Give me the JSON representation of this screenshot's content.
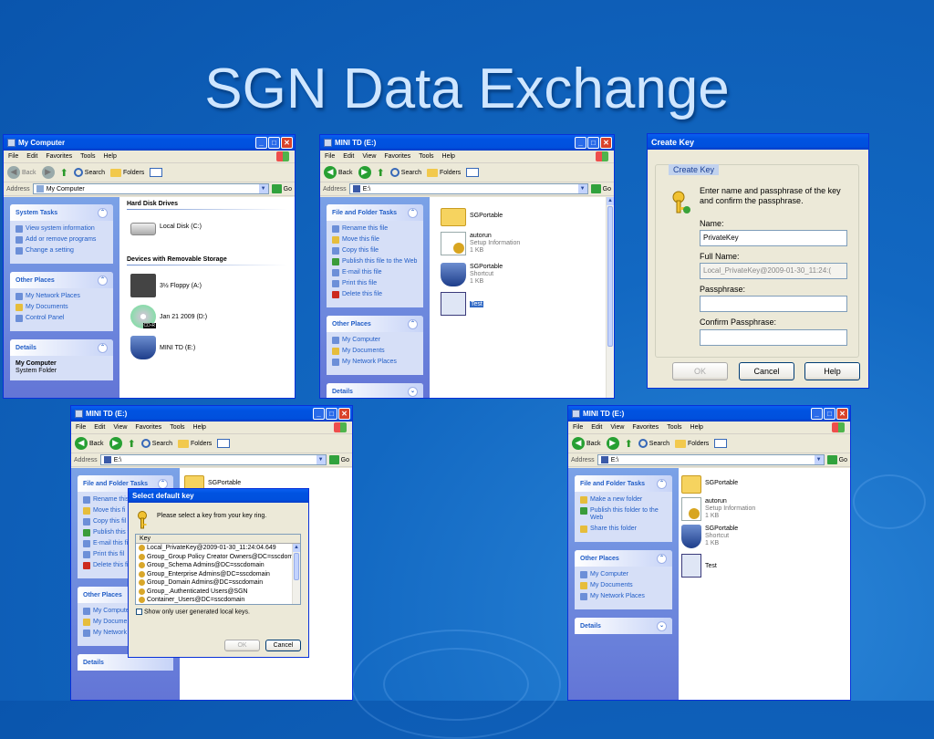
{
  "slide": {
    "title": "SGN Data Exchange"
  },
  "menu": {
    "file": "File",
    "edit": "Edit",
    "view": "View",
    "favorites": "Favorites",
    "tools": "Tools",
    "help": "Help"
  },
  "toolbar": {
    "back": "Back",
    "search": "Search",
    "folders": "Folders",
    "go": "Go",
    "address": "Address"
  },
  "windows": {
    "mycomputer": {
      "title": "My Computer",
      "address": "My Computer",
      "system_tasks": {
        "title": "System Tasks",
        "items": [
          "View system information",
          "Add or remove programs",
          "Change a setting"
        ]
      },
      "other_places": {
        "title": "Other Places",
        "items": [
          "My Network Places",
          "My Documents",
          "Control Panel"
        ]
      },
      "details": {
        "title": "Details",
        "name": "My Computer",
        "type": "System Folder"
      },
      "hdd_header": "Hard Disk Drives",
      "removable_header": "Devices with Removable Storage",
      "drives": [
        "Local Disk (C:)",
        "3½ Floppy (A:)",
        "Jan 21 2009 (D:)",
        "MINI TD (E:)"
      ],
      "cd_badge": "CD-R"
    },
    "minitd1": {
      "title": "MINI TD (E:)",
      "address": "E:\\",
      "tasks": {
        "title": "File and Folder Tasks",
        "items": [
          "Rename this file",
          "Move this file",
          "Copy this file",
          "Publish this file to the Web",
          "E-mail this file",
          "Print this file",
          "Delete this file"
        ]
      },
      "other_places": {
        "title": "Other Places",
        "items": [
          "My Computer",
          "My Documents",
          "My Network Places"
        ]
      },
      "details_title": "Details",
      "files": [
        {
          "name": "SGPortable",
          "sub1": "",
          "sub2": ""
        },
        {
          "name": "autorun",
          "sub1": "Setup Information",
          "sub2": "1 KB"
        },
        {
          "name": "SGPortable",
          "sub1": "Shortcut",
          "sub2": "1 KB"
        },
        {
          "name": "Test",
          "sub1": "",
          "sub2": ""
        }
      ]
    },
    "createkey": {
      "title": "Create Key",
      "legend": "Create Key",
      "instructions": "Enter name and passphrase of the key and confirm the passphrase.",
      "name_label": "Name:",
      "name_value": "PrivateKey",
      "fullname_label": "Full Name:",
      "fullname_value": "Local_PrivateKey@2009-01-30_11:24:(",
      "pass_label": "Passphrase:",
      "confirm_label": "Confirm Passphrase:",
      "ok": "OK",
      "cancel": "Cancel",
      "help": "Help"
    },
    "minitd2": {
      "title": "MINI TD (E:)",
      "address": "E:\\",
      "tasks_title": "File and Folder Tasks",
      "tasks_items": [
        "Rename this",
        "Move this fi",
        "Copy this fil",
        "Publish this fi",
        "E-mail this fi",
        "Print this fil",
        "Delete this fil"
      ],
      "other_title": "Other Places",
      "other_items": [
        "My Compute",
        "My Docume",
        "My Network"
      ],
      "details_title": "Details",
      "folder": "SGPortable"
    },
    "selectkey": {
      "title": "Select default key",
      "message": "Please select a key from your key ring.",
      "column": "Key",
      "keys": [
        "Local_PrivateKey@2009-01-30_11:24:04.649",
        "Group_Group Policy Creator Owners@DC=sscdomain",
        "Group_Schema Admins@DC=sscdomain",
        "Group_Enterprise Admins@DC=sscdomain",
        "Group_Domain Admins@DC=sscdomain",
        "Group_.Authenticated Users@SGN",
        "Container_Users@DC=sscdomain"
      ],
      "checkbox": "Show only user generated local keys.",
      "ok": "OK",
      "cancel": "Cancel"
    },
    "minitd3": {
      "title": "MINI TD (E:)",
      "address": "E:\\",
      "tasks": {
        "title": "File and Folder Tasks",
        "items": [
          "Make a new folder",
          "Publish this folder to the Web",
          "Share this folder"
        ]
      },
      "other_places": {
        "title": "Other Places",
        "items": [
          "My Computer",
          "My Documents",
          "My Network Places"
        ]
      },
      "details_title": "Details",
      "files": [
        {
          "name": "SGPortable",
          "sub1": "",
          "sub2": ""
        },
        {
          "name": "autorun",
          "sub1": "Setup Information",
          "sub2": "1 KB"
        },
        {
          "name": "SGPortable",
          "sub1": "Shortcut",
          "sub2": "1 KB"
        },
        {
          "name": "Test",
          "sub1": "",
          "sub2": ""
        }
      ]
    }
  }
}
